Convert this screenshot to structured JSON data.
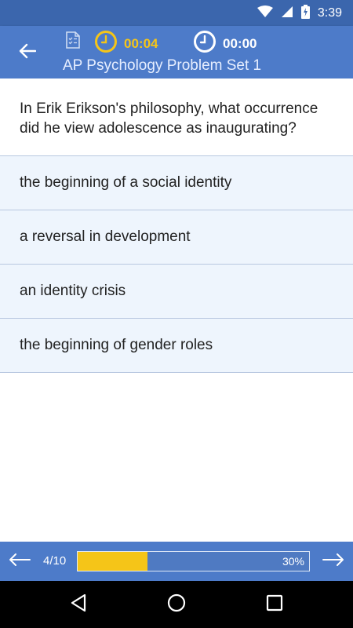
{
  "status_bar": {
    "time": "3:39"
  },
  "header": {
    "title": "AP Psychology Problem Set 1",
    "timer_elapsed": "00:04",
    "timer_total": "00:00"
  },
  "question": {
    "text": "In Erik Erikson's philosophy, what occurrence did he view adolescence as inaugurating?"
  },
  "answers": [
    {
      "label": "the beginning of a social identity"
    },
    {
      "label": "a reversal in development"
    },
    {
      "label": "an identity crisis"
    },
    {
      "label": "the beginning of gender roles"
    }
  ],
  "footer": {
    "page_counter": "4/10",
    "progress_percent": 30,
    "progress_label": "30%"
  },
  "colors": {
    "app_bar": "#4d7bc9",
    "status_bar": "#3b66ad",
    "accent": "#f5c518",
    "answer_bg": "#eef5fd"
  },
  "icons": [
    "wifi-icon",
    "signal-icon",
    "battery-icon",
    "back-arrow-icon",
    "document-checklist-icon",
    "clock-icon",
    "prev-arrow-icon",
    "next-arrow-icon",
    "back-triangle-icon",
    "home-circle-icon",
    "recents-square-icon"
  ]
}
